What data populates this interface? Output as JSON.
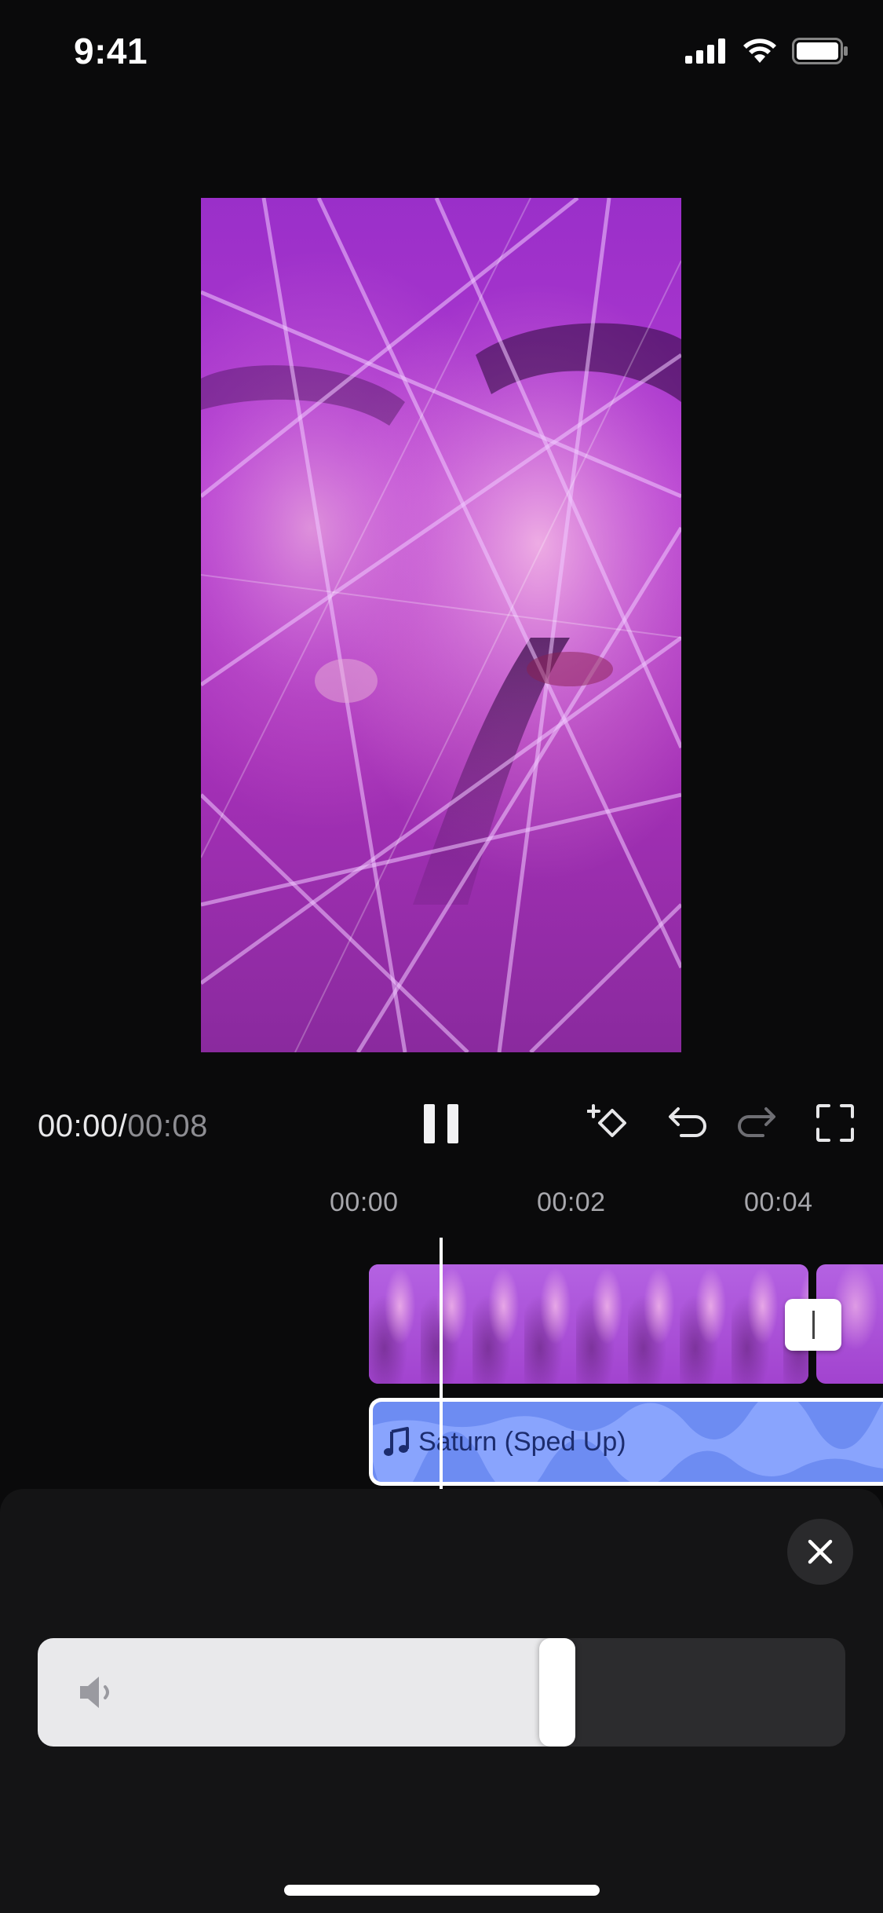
{
  "status_bar": {
    "time": "9:41"
  },
  "player": {
    "current_time": "00:00",
    "separator": "/",
    "total_time": "00:08",
    "state": "playing"
  },
  "toolbar": {
    "icons": [
      "keyframe-add-icon",
      "undo-icon",
      "redo-icon",
      "fullscreen-icon"
    ]
  },
  "ruler": {
    "labels": [
      "00:00",
      "00:02",
      "00:04"
    ]
  },
  "timeline": {
    "audio_clip_title": "Saturn (Sped Up)"
  },
  "volume_sheet": {
    "level": 0.65
  },
  "colors": {
    "background": "#0a0a0b",
    "sheet": "#141415",
    "audio_track": "#6d8cf2",
    "video_track": "#a344d6"
  }
}
